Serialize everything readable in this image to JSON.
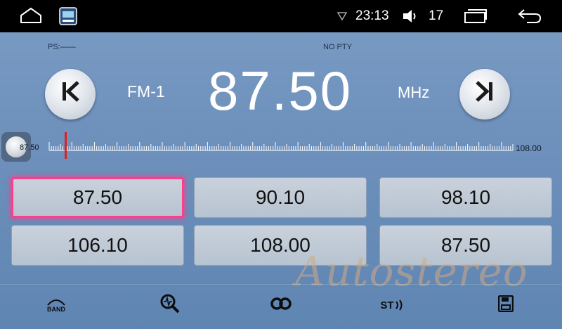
{
  "status_bar": {
    "time": "23:13",
    "volume": "17",
    "icons": [
      "home-icon",
      "app-icon",
      "wifi-icon",
      "volume-icon",
      "recents-icon",
      "back-icon"
    ]
  },
  "radio": {
    "ps_label": "PS:——",
    "pty_label": "NO PTY",
    "band": "FM-1",
    "frequency": "87.50",
    "unit": "MHz",
    "prev_icon": "seek-back-icon",
    "next_icon": "seek-forward-icon"
  },
  "scale": {
    "min_label": "87.50",
    "max_label": "108.00",
    "min": 87.5,
    "max": 108.0,
    "current": 87.5
  },
  "presets": [
    {
      "freq": "87.50",
      "active": true
    },
    {
      "freq": "90.10",
      "active": false
    },
    {
      "freq": "98.10",
      "active": false
    },
    {
      "freq": "106.10",
      "active": false
    },
    {
      "freq": "108.00",
      "active": false
    },
    {
      "freq": "87.50",
      "active": false
    }
  ],
  "toolbar": {
    "band_label": "BAND",
    "st_label": "ST",
    "icons": [
      "band-icon",
      "search-scan-icon",
      "loudness-icon",
      "stereo-icon",
      "save-icon"
    ]
  },
  "watermark": "Autostereo",
  "colors": {
    "active_preset": "#ff3d8a",
    "background": "#6f92bd",
    "tuner_needle": "#e02020"
  }
}
